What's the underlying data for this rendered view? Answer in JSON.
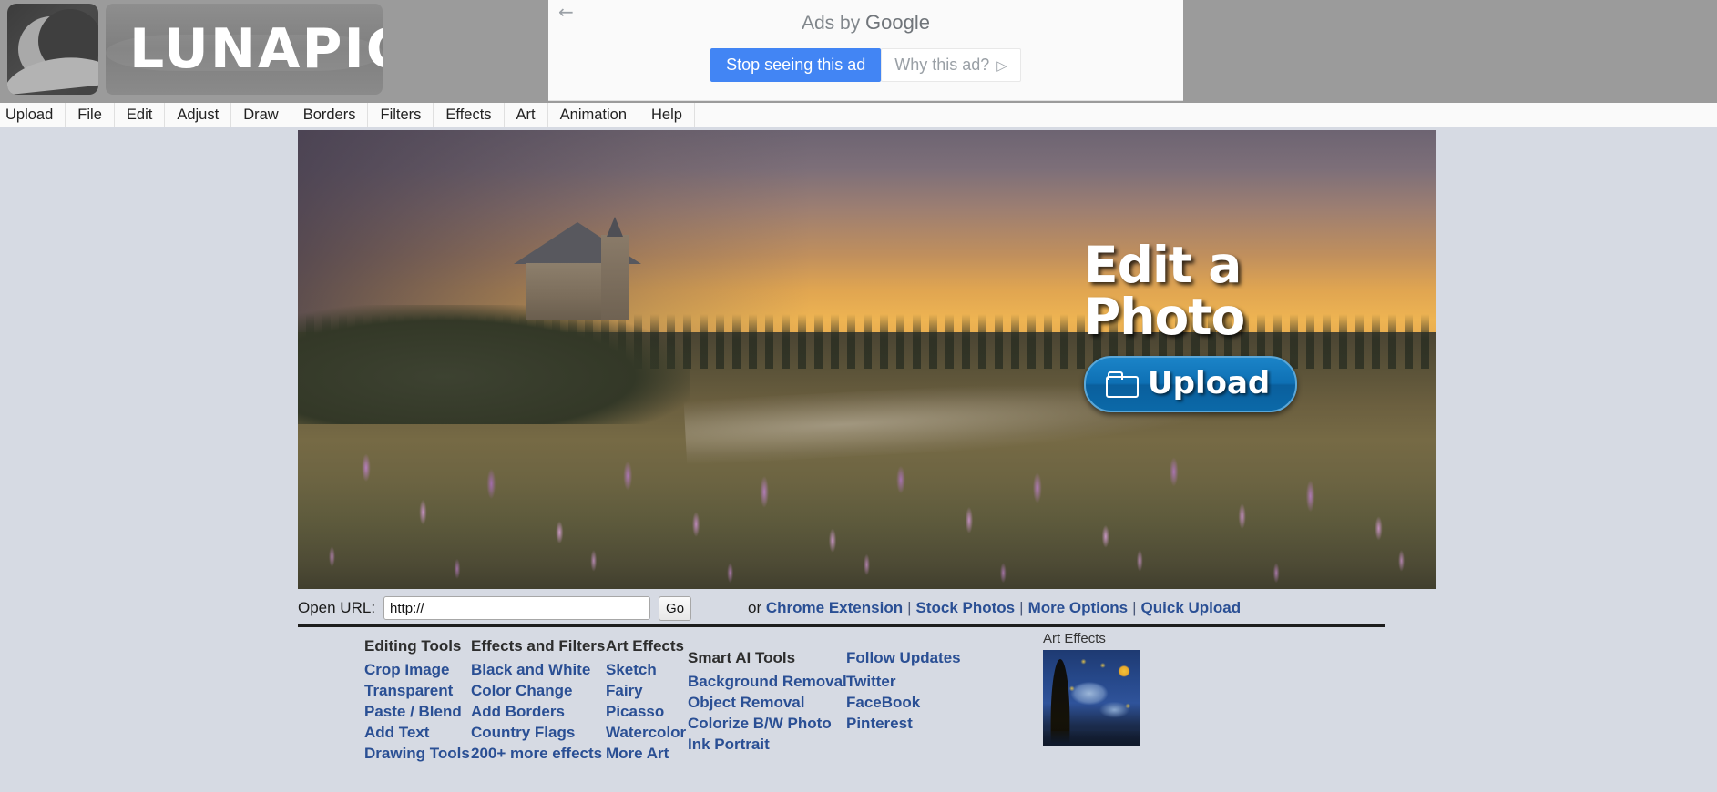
{
  "brand": {
    "logo_text": "LUNAPIC",
    "logo_icon": "crescent-moon-icon"
  },
  "ad": {
    "back_icon": "back-arrow-icon",
    "ads_by_prefix": "Ads by ",
    "ads_by_provider": "Google",
    "stop_button": "Stop seeing this ad",
    "why_button": "Why this ad?",
    "why_caret_icon": "play-triangle-icon"
  },
  "menu": {
    "items": [
      {
        "label": "Upload"
      },
      {
        "label": "File"
      },
      {
        "label": "Edit"
      },
      {
        "label": "Adjust"
      },
      {
        "label": "Draw"
      },
      {
        "label": "Borders"
      },
      {
        "label": "Filters"
      },
      {
        "label": "Effects"
      },
      {
        "label": "Art"
      },
      {
        "label": "Animation"
      },
      {
        "label": "Help"
      }
    ]
  },
  "hero": {
    "title_line1": "Edit a",
    "title_line2": "Photo",
    "upload_button": "Upload",
    "folder_icon": "folder-icon",
    "alt": "Church of the Good Shepherd at sunset with purple lupine flowers"
  },
  "url_bar": {
    "label": "Open URL:",
    "value": "http://",
    "placeholder": "http://",
    "go_button": "Go",
    "or_text": "or ",
    "links": [
      {
        "label": "Chrome Extension"
      },
      {
        "label": "Stock Photos"
      },
      {
        "label": "More Options"
      },
      {
        "label": "Quick Upload"
      }
    ],
    "separator": "|"
  },
  "footer": {
    "columns": [
      {
        "heading": "Editing Tools",
        "heading_is_link": false,
        "items": [
          {
            "label": "Crop Image"
          },
          {
            "label": "Transparent"
          },
          {
            "label": "Paste / Blend"
          },
          {
            "label": "Add Text"
          },
          {
            "label": "Drawing Tools"
          }
        ]
      },
      {
        "heading": "Effects and Filters",
        "heading_is_link": false,
        "items": [
          {
            "label": "Black and White"
          },
          {
            "label": "Color Change"
          },
          {
            "label": "Add Borders"
          },
          {
            "label": "Country Flags"
          },
          {
            "label": "200+ more effects"
          }
        ]
      },
      {
        "heading": "Art Effects",
        "heading_is_link": false,
        "items": [
          {
            "label": "Sketch"
          },
          {
            "label": "Fairy"
          },
          {
            "label": "Picasso"
          },
          {
            "label": "Watercolor"
          },
          {
            "label": "More Art"
          }
        ]
      },
      {
        "heading": "Smart AI Tools",
        "heading_is_link": false,
        "items": [
          {
            "label": "Background Removal"
          },
          {
            "label": "Object Removal"
          },
          {
            "label": "Colorize B/W Photo"
          },
          {
            "label": "Ink Portrait"
          }
        ]
      },
      {
        "heading": "Follow Updates",
        "heading_is_link": true,
        "items": [
          {
            "label": "Twitter"
          },
          {
            "label": "FaceBook"
          },
          {
            "label": "Pinterest"
          }
        ]
      }
    ],
    "art_thumb": {
      "caption": "Art Effects",
      "alt": "Starry Night painting thumbnail"
    }
  },
  "colors": {
    "page_background": "#d6dae3",
    "topbar_background": "#9b9b9b",
    "link_blue": "#2a4f94",
    "ad_blue": "#4285f4",
    "upload_button_blue": "#0e70b4"
  }
}
